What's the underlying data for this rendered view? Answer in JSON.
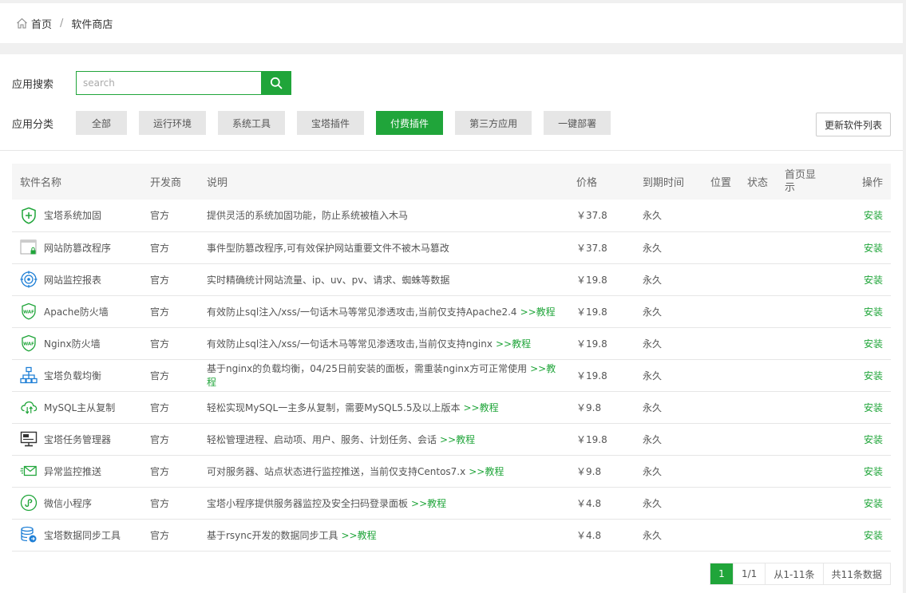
{
  "breadcrumb": {
    "home": "首页",
    "separator": "/",
    "current": "软件商店"
  },
  "search": {
    "label": "应用搜索",
    "placeholder": "search"
  },
  "category": {
    "label": "应用分类",
    "items": [
      "全部",
      "运行环境",
      "系统工具",
      "宝塔插件",
      "付费插件",
      "第三方应用",
      "一键部署"
    ],
    "active": "付费插件"
  },
  "refresh_label": "更新软件列表",
  "table": {
    "headers": [
      "软件名称",
      "开发商",
      "说明",
      "价格",
      "到期时间",
      "位置",
      "状态",
      "首页显示",
      "操作"
    ],
    "rows": [
      {
        "icon": "shield-plus-icon",
        "name": "宝塔系统加固",
        "dev": "官方",
        "desc": "提供灵活的系统加固功能，防止系统被植入木马",
        "tutorial": "",
        "price": "￥37.8",
        "expire": "永久",
        "op": "安装"
      },
      {
        "icon": "window-lock-icon",
        "name": "网站防篡改程序",
        "dev": "官方",
        "desc": "事件型防篡改程序,可有效保护网站重要文件不被木马篡改",
        "tutorial": "",
        "price": "￥37.8",
        "expire": "永久",
        "op": "安装"
      },
      {
        "icon": "target-icon",
        "name": "网站监控报表",
        "dev": "官方",
        "desc": "实时精确统计网站流量、ip、uv、pv、请求、蜘蛛等数据",
        "tutorial": "",
        "price": "￥19.8",
        "expire": "永久",
        "op": "安装"
      },
      {
        "icon": "waf-shield-icon",
        "name": "Apache防火墙",
        "dev": "官方",
        "desc": "有效防止sql注入/xss/一句话木马等常见渗透攻击,当前仅支持Apache2.4",
        "tutorial": ">>教程",
        "price": "￥19.8",
        "expire": "永久",
        "op": "安装"
      },
      {
        "icon": "waf-shield-icon",
        "name": "Nginx防火墙",
        "dev": "官方",
        "desc": "有效防止sql注入/xss/一句话木马等常见渗透攻击,当前仅支持nginx",
        "tutorial": ">>教程",
        "price": "￥19.8",
        "expire": "永久",
        "op": "安装"
      },
      {
        "icon": "network-tree-icon",
        "name": "宝塔负载均衡",
        "dev": "官方",
        "desc": "基于nginx的负载均衡，04/25日前安装的面板，需重装nginx方可正常使用",
        "tutorial": ">>教程",
        "price": "￥19.8",
        "expire": "永久",
        "op": "安装"
      },
      {
        "icon": "cloud-sync-icon",
        "name": "MySQL主从复制",
        "dev": "官方",
        "desc": "轻松实现MySQL一主多从复制，需要MySQL5.5及以上版本",
        "tutorial": ">>教程",
        "price": "￥9.8",
        "expire": "永久",
        "op": "安装"
      },
      {
        "icon": "monitor-icon",
        "name": "宝塔任务管理器",
        "dev": "官方",
        "desc": "轻松管理进程、启动项、用户、服务、计划任务、会话",
        "tutorial": ">>教程",
        "price": "￥19.8",
        "expire": "永久",
        "op": "安装"
      },
      {
        "icon": "mail-send-icon",
        "name": "异常监控推送",
        "dev": "官方",
        "desc": "可对服务器、站点状态进行监控推送，当前仅支持Centos7.x",
        "tutorial": ">>教程",
        "price": "￥9.8",
        "expire": "永久",
        "op": "安装"
      },
      {
        "icon": "mini-program-icon",
        "name": "微信小程序",
        "dev": "官方",
        "desc": "宝塔小程序提供服务器监控及安全扫码登录面板",
        "tutorial": ">>教程",
        "price": "￥4.8",
        "expire": "永久",
        "op": "安装"
      },
      {
        "icon": "database-sync-icon",
        "name": "宝塔数据同步工具",
        "dev": "官方",
        "desc": "基于rsync开发的数据同步工具",
        "tutorial": ">>教程",
        "price": "￥4.8",
        "expire": "永久",
        "op": "安装"
      }
    ]
  },
  "pager": {
    "current": "1",
    "pages": "1/1",
    "range": "从1-11条",
    "total": "共11条数据"
  },
  "colors": {
    "accent": "#20a53a",
    "price": "#fc6d26"
  }
}
